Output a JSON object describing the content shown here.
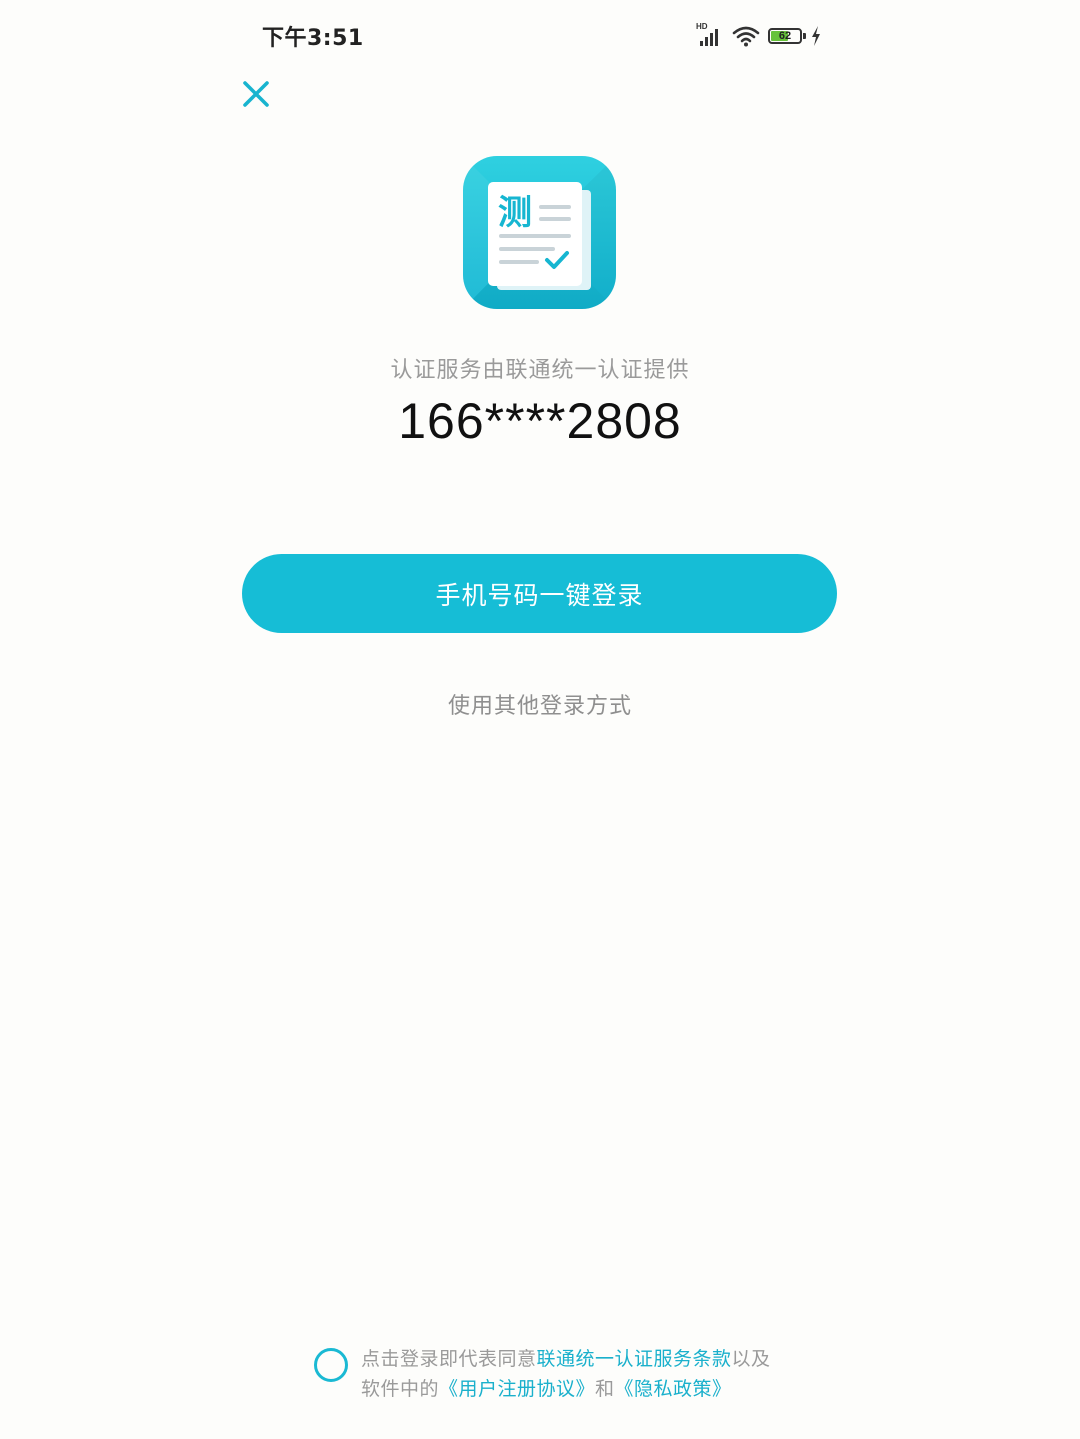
{
  "status_bar": {
    "time": "下午3:51",
    "network_label": "HD",
    "battery_level": "62",
    "battery_fraction": 0.62,
    "charging": true
  },
  "colors": {
    "accent": "#16bdd6",
    "link": "#1ab0cc",
    "muted_text": "#9a9a9a",
    "background": "#fdfdfb"
  },
  "close": {
    "icon": "close-icon"
  },
  "app_icon": {
    "glyph": "测",
    "icon": "app-logo-icon"
  },
  "auth": {
    "provider_text": "认证服务由联通统一认证提供",
    "phone_masked": "166****2808"
  },
  "login_button": {
    "label": "手机号码一键登录"
  },
  "other_login": {
    "label": "使用其他登录方式"
  },
  "agreement": {
    "prefix": "点击登录即代表同意",
    "link_service_terms": "联通统一认证服务条款",
    "mid1": "以及软件中的",
    "link_user_agreement": "《用户注册协议》",
    "mid2": "和",
    "link_privacy": "《隐私政策》",
    "checked": false
  }
}
